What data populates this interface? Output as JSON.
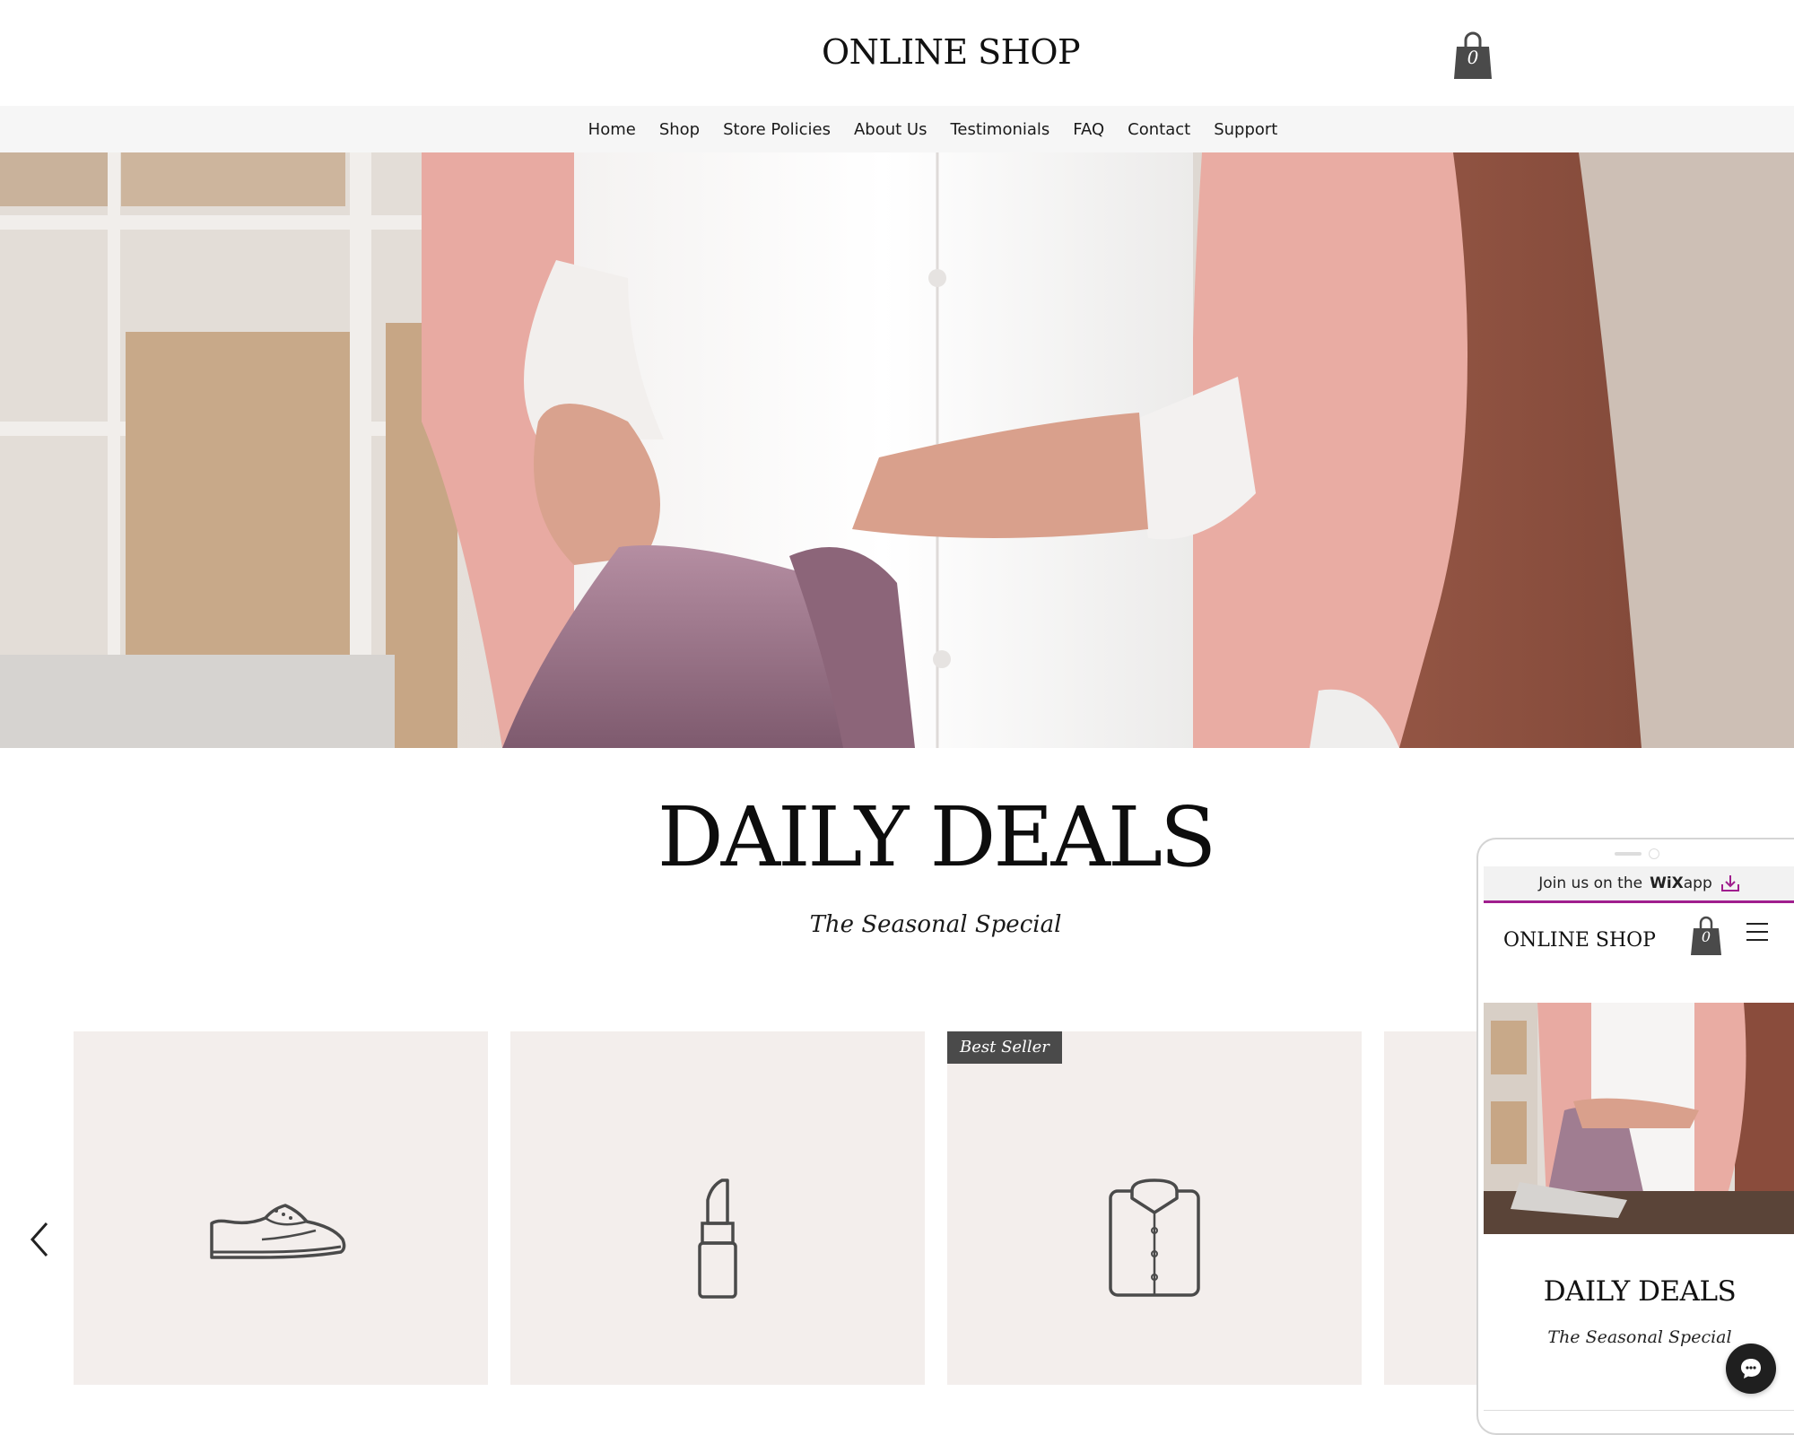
{
  "header": {
    "site_title": "ONLINE SHOP",
    "cart_count": "0"
  },
  "nav": {
    "items": [
      "Home",
      "Shop",
      "Store Policies",
      "About Us",
      "Testimonials",
      "FAQ",
      "Contact",
      "Support"
    ]
  },
  "hero": {
    "image": "woman-folding-mauve-garment"
  },
  "deals": {
    "title": "DAILY DEALS",
    "subtitle": "The Seasonal Special"
  },
  "products": [
    {
      "icon": "shoe-icon",
      "badge": ""
    },
    {
      "icon": "lipstick-icon",
      "badge": ""
    },
    {
      "icon": "shirt-icon",
      "badge": "Best Seller"
    },
    {
      "icon": "",
      "badge": ""
    }
  ],
  "mobile_preview": {
    "banner_text": "Join us on the",
    "banner_brand": "WiX",
    "banner_suffix": "app",
    "site_title": "ONLINE SHOP",
    "cart_count": "0",
    "deals_title": "DAILY DEALS",
    "deals_subtitle": "The Seasonal Special"
  },
  "colors": {
    "card_bg": "#f3eeec",
    "badge_bg": "#4a4a4a",
    "nav_bg": "#f6f6f6",
    "wix_accent": "#a01e8e",
    "icon_stroke": "#4a4a4a"
  }
}
